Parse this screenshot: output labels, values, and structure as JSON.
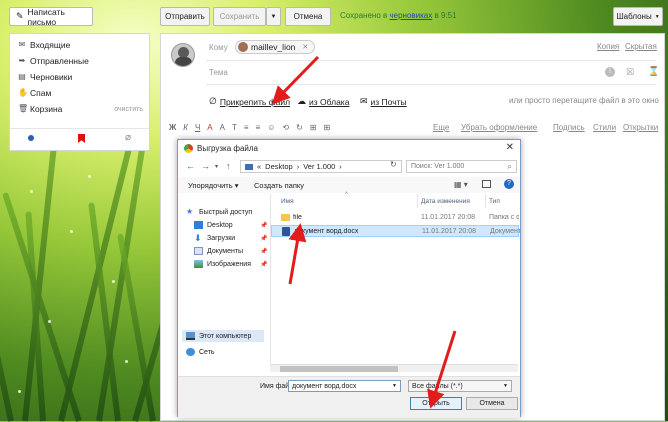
{
  "sidebar": {
    "compose_label": "Написать письмо",
    "folders": [
      {
        "label": "Входящие",
        "icon": "inbox-icon"
      },
      {
        "label": "Отправленные",
        "icon": "sent-icon"
      },
      {
        "label": "Черновики",
        "icon": "drafts-icon"
      },
      {
        "label": "Спам",
        "icon": "spam-icon"
      },
      {
        "label": "Корзина",
        "icon": "trash-icon"
      }
    ],
    "clear_label": "очистить"
  },
  "toolbar": {
    "send_label": "Отправить",
    "save_label": "Сохранить",
    "cancel_label": "Отмена",
    "status_prefix": "Сохранено в ",
    "status_link": "черновиках",
    "status_suffix": " в 9:51",
    "templates_label": "Шаблоны"
  },
  "compose": {
    "to_label": "Кому",
    "recipient": "maillev_lion",
    "copy_link": "Копия",
    "bcc_link": "Скрытая",
    "subject_label": "Тема",
    "attach_label": "Прикрепить файл",
    "cloud_label": "из Облака",
    "mail_label": "из Почты",
    "drop_hint": "или просто перетащите файл в это окно",
    "format_buttons": [
      "Ж",
      "К",
      "Ч",
      "А",
      "А",
      "Т",
      "≡",
      "≡",
      "☺",
      "⟲",
      "↻",
      "⊞",
      "⊞"
    ],
    "more_label": "Еще",
    "remove_format_label": "Убрать оформление",
    "signature_label": "Подпись",
    "styles_label": "Стили",
    "cards_label": "Открытки"
  },
  "dialog": {
    "title": "Выгрузка файла",
    "address_parts": [
      "«",
      "Desktop",
      "›",
      "Ver 1.000",
      "›"
    ],
    "search_placeholder": "Поиск: Ver 1.000",
    "organize_label": "Упорядочить ▾",
    "new_folder_label": "Создать папку",
    "tree": [
      {
        "label": "Быстрый доступ"
      },
      {
        "label": "Desktop"
      },
      {
        "label": "Загрузки"
      },
      {
        "label": "Документы"
      },
      {
        "label": "Изображения"
      },
      {
        "label": "Этот компьютер"
      },
      {
        "label": "Сеть"
      }
    ],
    "columns": [
      "Имя",
      "Дата изменения",
      "Тип"
    ],
    "files": [
      {
        "name": "file",
        "date": "11.01.2017 20:08",
        "type": "Папка с фай"
      },
      {
        "name": "документ ворд.docx",
        "date": "11.01.2017 20:08",
        "type": "Документ M"
      }
    ],
    "filename_label": "Имя файла:",
    "filename_value": "документ ворд.docx",
    "filter_value": "Все файлы (*.*)",
    "open_label": "Открыть",
    "cancel_label": "Отмена"
  },
  "colors": {
    "accent_green": "#2c7a2c",
    "link_blue": "#1a4ea8",
    "arrow_red": "#e31b1b"
  }
}
